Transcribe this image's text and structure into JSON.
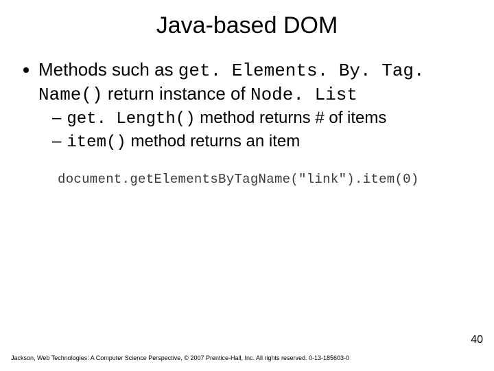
{
  "title": "Java-based DOM",
  "bullet": {
    "pre": "Methods such as ",
    "code1": "get. Elements. By. Tag. Name()",
    "mid": " return instance of ",
    "code2": "Node. List"
  },
  "subs": [
    {
      "code": "get. Length()",
      "rest": "  method returns # of items"
    },
    {
      "code": "item()",
      "rest": " method returns an item"
    }
  ],
  "codeline": "document.getElementsByTagName(\"link\").item(0)",
  "pagenum": "40",
  "footer": "Jackson, Web Technologies: A Computer Science Perspective, © 2007 Prentice-Hall, Inc. All rights reserved. 0-13-185603-0"
}
